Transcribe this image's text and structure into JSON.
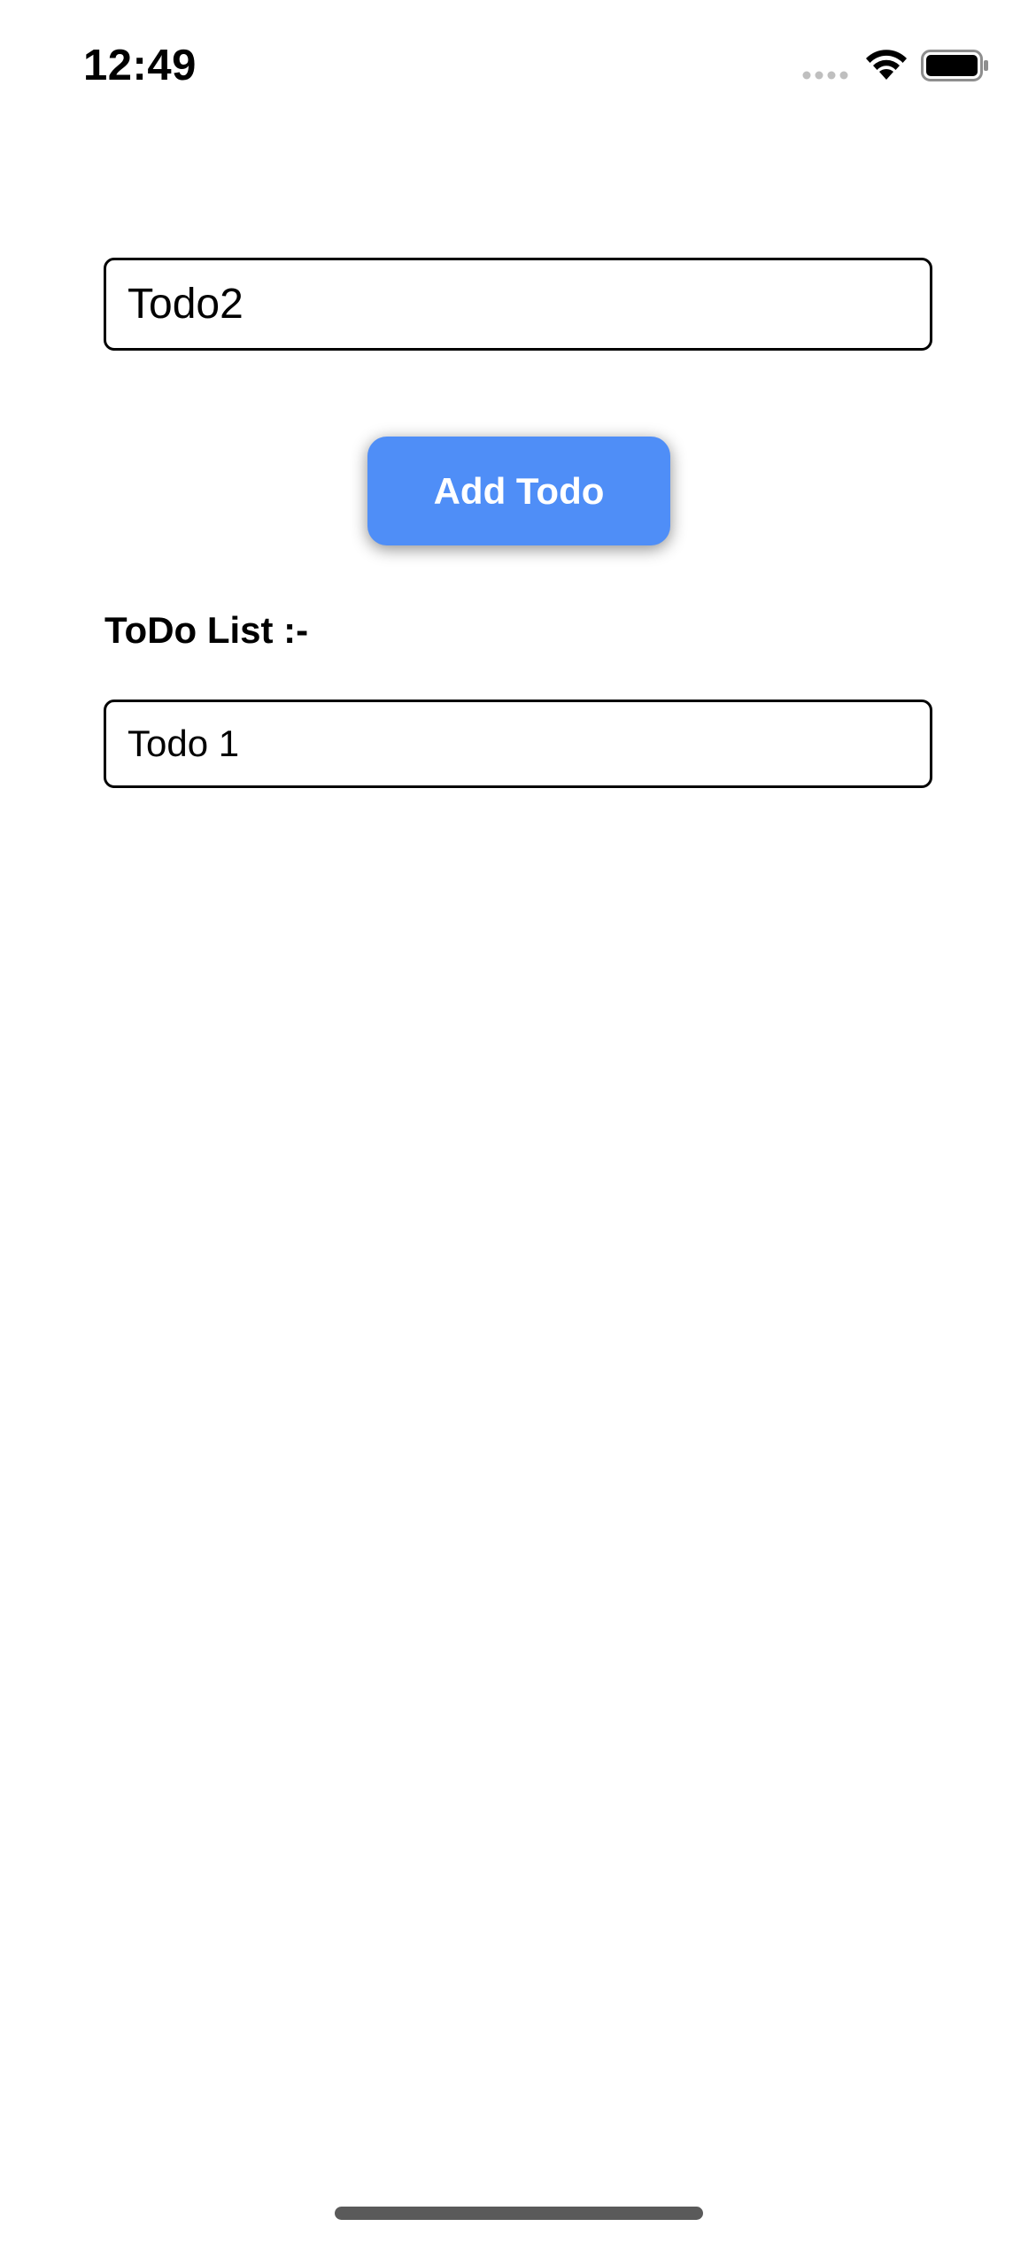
{
  "status_bar": {
    "time": "12:49"
  },
  "todo_input": {
    "value": "Todo2"
  },
  "add_button": {
    "label": "Add Todo"
  },
  "list": {
    "heading": "ToDo List :-",
    "items": [
      {
        "label": "Todo 1"
      }
    ]
  },
  "colors": {
    "accent": "#4f8ef7",
    "button_text": "#ffffff",
    "border": "#000000",
    "background": "#ffffff"
  },
  "icons": {
    "cellular": "cellular-signal-icon",
    "wifi": "wifi-icon",
    "battery": "battery-icon"
  }
}
